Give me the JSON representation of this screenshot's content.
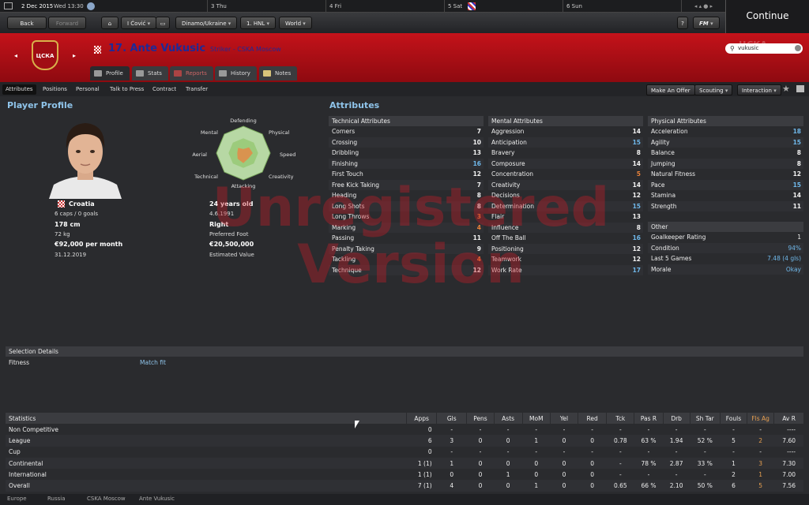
{
  "topbar": {
    "date": "2 Dec 2015",
    "weekday_time": "Wed 13:30",
    "days": [
      "3 Thu",
      "4 Fri",
      "5 Sat",
      "6 Sun"
    ],
    "continue": "Continue"
  },
  "nav": {
    "back": "Back",
    "forward": "Forward",
    "manager": "I Ćović",
    "team": "Dinamo/Ukraine",
    "league": "1. HNL",
    "world": "World",
    "help": "?",
    "fm": "FM"
  },
  "club": {
    "badge_text": "ЦСКА",
    "player_title": "17. Ante Vukusic",
    "player_role": "Striker - CSKA Moscow"
  },
  "search": {
    "value": "vukusic"
  },
  "tabs": [
    "Profile",
    "Stats",
    "Reports",
    "History",
    "Notes"
  ],
  "subnav": [
    "Attributes",
    "Positions",
    "Personal",
    "Talk to Press",
    "Contract",
    "Transfer"
  ],
  "actions": {
    "offer": "Make An Offer",
    "scouting": "Scouting",
    "interaction": "Interaction"
  },
  "profile": {
    "heading": "Player Profile",
    "nation": "Croatia",
    "caps": "6 caps / 0 goals",
    "height": "178 cm",
    "weight": "72 kg",
    "wage": "€92,000 per month",
    "contract": "31.12.2019",
    "age": "24 years old",
    "dob": "4.6.1991",
    "foot": "Right",
    "foot_label": "Preferred Foot",
    "value": "€20,500,000",
    "value_label": "Estimated Value"
  },
  "radar": {
    "labels": [
      "Defending",
      "Physical",
      "Speed",
      "Creativity",
      "Attacking",
      "Technical",
      "Aerial",
      "Mental"
    ],
    "levels": [
      0.3,
      0.6,
      0.7,
      0.55,
      0.75,
      0.6,
      0.45,
      0.55
    ],
    "colors": {
      "outer": "#b7d8a4",
      "inner": "#e48a48"
    }
  },
  "attributes": {
    "heading": "Attributes",
    "technical": {
      "title": "Technical Attributes",
      "rows": [
        [
          "Corners",
          "7"
        ],
        [
          "Crossing",
          "10"
        ],
        [
          "Dribbling",
          "13"
        ],
        [
          "Finishing",
          "16"
        ],
        [
          "First Touch",
          "12"
        ],
        [
          "Free Kick Taking",
          "7"
        ],
        [
          "Heading",
          "8"
        ],
        [
          "Long Shots",
          "8"
        ],
        [
          "Long Throws",
          "3"
        ],
        [
          "Marking",
          "4"
        ],
        [
          "Passing",
          "11"
        ],
        [
          "Penalty Taking",
          "9"
        ],
        [
          "Tackling",
          "4"
        ],
        [
          "Technique",
          "12"
        ]
      ]
    },
    "mental": {
      "title": "Mental Attributes",
      "rows": [
        [
          "Aggression",
          "14"
        ],
        [
          "Anticipation",
          "15"
        ],
        [
          "Bravery",
          "8"
        ],
        [
          "Composure",
          "14"
        ],
        [
          "Concentration",
          "5"
        ],
        [
          "Creativity",
          "14"
        ],
        [
          "Decisions",
          "12"
        ],
        [
          "Determination",
          "15"
        ],
        [
          "Flair",
          "13"
        ],
        [
          "Influence",
          "8"
        ],
        [
          "Off The Ball",
          "16"
        ],
        [
          "Positioning",
          "12"
        ],
        [
          "Teamwork",
          "12"
        ],
        [
          "Work Rate",
          "17"
        ]
      ]
    },
    "physical": {
      "title": "Physical Attributes",
      "rows": [
        [
          "Acceleration",
          "18"
        ],
        [
          "Agility",
          "15"
        ],
        [
          "Balance",
          "8"
        ],
        [
          "Jumping",
          "8"
        ],
        [
          "Natural Fitness",
          "12"
        ],
        [
          "Pace",
          "15"
        ],
        [
          "Stamina",
          "14"
        ],
        [
          "Strength",
          "11"
        ]
      ]
    },
    "other": {
      "title": "Other",
      "rows": [
        [
          "Goalkeeper Rating",
          "1"
        ],
        [
          "Condition",
          "94%"
        ],
        [
          "Last 5 Games",
          "7.48 (4 gls)"
        ],
        [
          "Morale",
          "Okay"
        ]
      ]
    }
  },
  "selection": {
    "title": "Selection Details",
    "label": "Fitness",
    "value": "Match fit"
  },
  "stats": {
    "headers": [
      "Statistics",
      "Apps",
      "Gls",
      "Pens",
      "Asts",
      "MoM",
      "Yel",
      "Red",
      "Tck",
      "Pas R",
      "Drb",
      "Sh Tar",
      "Fouls",
      "Fls Ag",
      "Av R"
    ],
    "rows": [
      [
        "Non Competitive",
        "0",
        "-",
        "-",
        "-",
        "-",
        "-",
        "-",
        "-",
        "-",
        "-",
        "-",
        "-",
        "-",
        "----"
      ],
      [
        "League",
        "6",
        "3",
        "0",
        "0",
        "1",
        "0",
        "0",
        "0.78",
        "63 %",
        "1.94",
        "52 %",
        "5",
        "2",
        "7.60"
      ],
      [
        "Cup",
        "0",
        "-",
        "-",
        "-",
        "-",
        "-",
        "-",
        "-",
        "-",
        "-",
        "-",
        "-",
        "-",
        "----"
      ],
      [
        "Continental",
        "1 (1)",
        "1",
        "0",
        "0",
        "0",
        "0",
        "0",
        "-",
        "78 %",
        "2.87",
        "33 %",
        "1",
        "3",
        "7.30"
      ],
      [
        "International",
        "1 (1)",
        "0",
        "0",
        "1",
        "0",
        "0",
        "0",
        "-",
        "-",
        "-",
        "-",
        "2",
        "1",
        "7.00"
      ],
      [
        "Overall",
        "7 (1)",
        "4",
        "0",
        "0",
        "1",
        "0",
        "0",
        "0.65",
        "66 %",
        "2.10",
        "50 %",
        "6",
        "5",
        "7.56"
      ]
    ]
  },
  "breadcrumbs": [
    "Europe",
    "Russia",
    "CSKA Moscow",
    "Ante Vukusic"
  ],
  "watermark": {
    "line1": "Unregistered",
    "line2": "Version"
  },
  "colors": {
    "accent": "#c4121a",
    "high": "#6fb8ea",
    "low": "#e8823a"
  }
}
